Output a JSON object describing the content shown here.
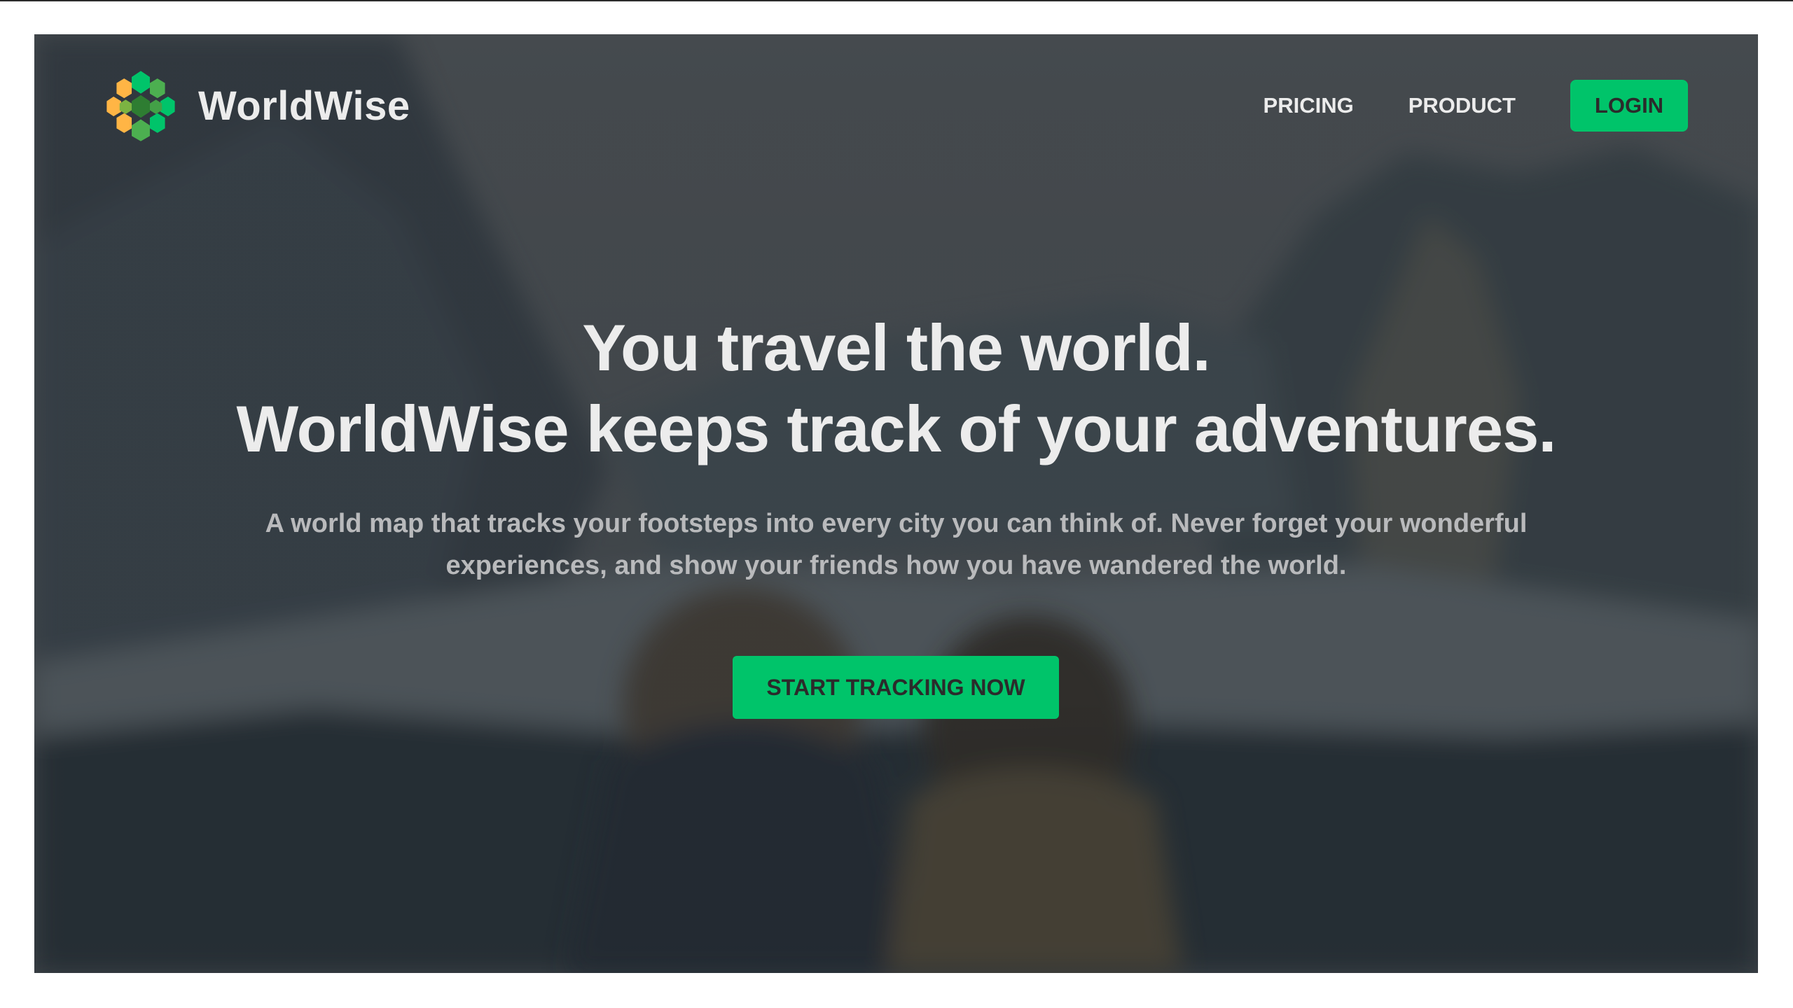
{
  "brand": {
    "name": "WorldWise",
    "logo_icon": "globe-hexagon-icon",
    "logo_colors": [
      "#ffb545",
      "#00c46a",
      "#4caf50"
    ]
  },
  "nav": {
    "links": [
      {
        "label": "PRICING"
      },
      {
        "label": "PRODUCT"
      }
    ],
    "login_label": "LOGIN"
  },
  "hero": {
    "title_line1": "You travel the world.",
    "title_line2": "WorldWise keeps track of your adventures.",
    "description": "A world map that tracks your footsteps into every city you can think of. Never forget your wonderful experiences, and show your friends how you have wandered the world.",
    "cta_label": "START TRACKING NOW"
  },
  "colors": {
    "accent": "#00c46a",
    "text_light": "#ececec",
    "text_muted": "#b9babc",
    "overlay": "#242a2e"
  }
}
